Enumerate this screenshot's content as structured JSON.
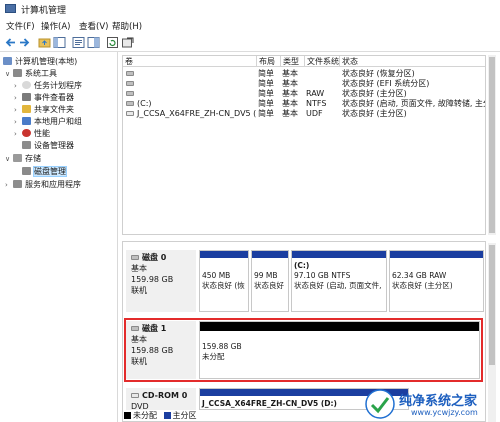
{
  "window": {
    "title": "计算机管理"
  },
  "menu": [
    "文件(F)",
    "操作(A)",
    "查看(V)",
    "帮助(H)"
  ],
  "toolbar": [
    "back-arrow-icon",
    "forward-arrow-icon",
    "up-folder-icon",
    "show-hide-tree-icon",
    "properties-icon",
    "help-icon",
    "refresh-icon",
    "export-icon"
  ],
  "tree": {
    "root": "计算机管理(本地)",
    "system_tools": "系统工具",
    "task_scheduler": "任务计划程序",
    "event_viewer": "事件查看器",
    "shared_folders": "共享文件夹",
    "local_users": "本地用户和组",
    "performance": "性能",
    "device_manager": "设备管理器",
    "storage": "存储",
    "disk_mgmt": "磁盘管理",
    "services": "服务和应用程序"
  },
  "volumes": {
    "headers": [
      "卷",
      "布局",
      "类型",
      "文件系统",
      "状态"
    ],
    "rows": [
      {
        "vol": "",
        "layout": "简单",
        "type": "基本",
        "fs": "",
        "status": "状态良好 (恢复分区)"
      },
      {
        "vol": "",
        "layout": "简单",
        "type": "基本",
        "fs": "",
        "status": "状态良好 (EFI 系统分区)"
      },
      {
        "vol": "",
        "layout": "简单",
        "type": "基本",
        "fs": "RAW",
        "status": "状态良好 (主分区)"
      },
      {
        "vol": "(C:)",
        "layout": "简单",
        "type": "基本",
        "fs": "NTFS",
        "status": "状态良好 (启动, 页面文件, 故障转储, 主分区)"
      },
      {
        "vol": "J_CCSA_X64FRE_ZH-CN_DV5 (D:)",
        "layout": "简单",
        "type": "基本",
        "fs": "UDF",
        "status": "状态良好 (主分区)"
      }
    ]
  },
  "disks": [
    {
      "name": "磁盘 0",
      "kind": "基本",
      "size": "159.98 GB",
      "state": "联机",
      "partitions": [
        {
          "title": "",
          "size": "450 MB",
          "status": "状态良好 (恢"
        },
        {
          "title": "",
          "size": "99 MB",
          "status": "状态良好"
        },
        {
          "title": "(C:)",
          "size": "97.10 GB NTFS",
          "status": "状态良好 (启动, 页面文件,"
        },
        {
          "title": "",
          "size": "62.34 GB RAW",
          "status": "状态良好 (主分区)"
        }
      ]
    },
    {
      "name": "磁盘 1",
      "kind": "基本",
      "size": "159.88 GB",
      "state": "联机",
      "partitions": [
        {
          "title": "",
          "size": "159.88 GB",
          "status": "未分配"
        }
      ]
    },
    {
      "name": "CD-ROM 0",
      "kind": "DVD",
      "size": "",
      "state": "",
      "partitions": [
        {
          "title": "J_CCSA_X64FRE_ZH-CN_DV5 (D:)",
          "size": "",
          "status": ""
        }
      ]
    }
  ],
  "legend": {
    "unalloc": "未分配",
    "primary": "主分区"
  },
  "watermark": {
    "title": "纯净系统之家",
    "url": "www.ycwjzy.com"
  },
  "colors": {
    "unalloc": "#000000",
    "primary": "#1b3ea0",
    "highlight": "#e32b2b",
    "selection": "#cce8ff"
  }
}
